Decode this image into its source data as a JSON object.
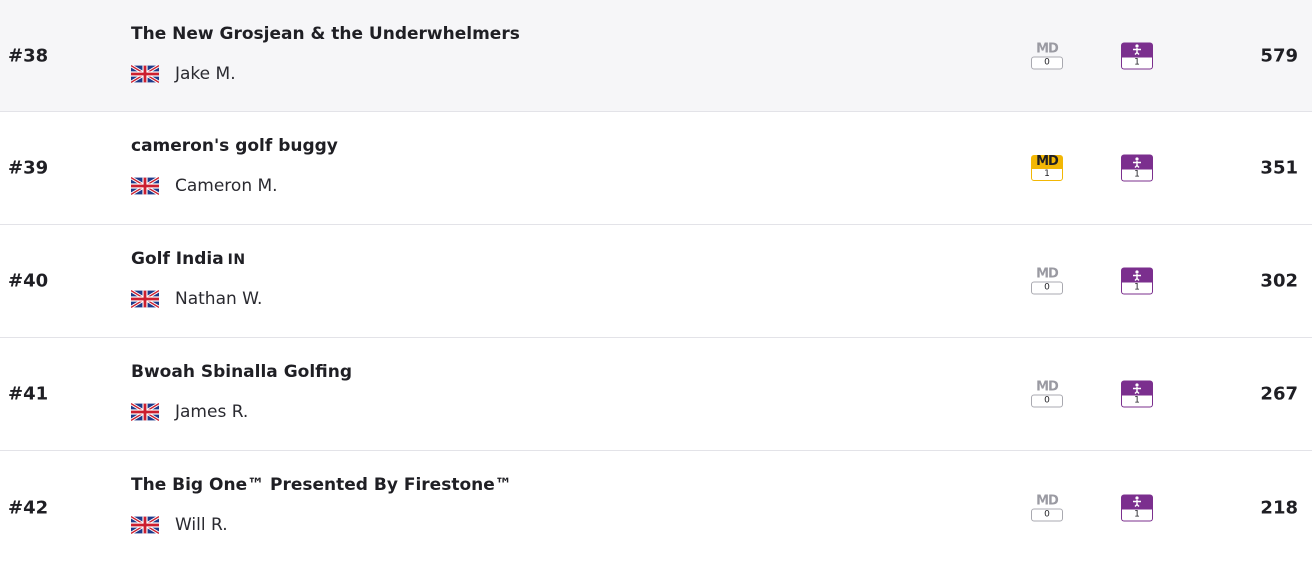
{
  "standings": {
    "rows": [
      {
        "rank": "#38",
        "team": "The New Grosjean & the Underwhelmers",
        "tag": "",
        "manager": "Jake M.",
        "flag_icon": "uk-flag-icon",
        "md_label": "MD",
        "md_value": "0",
        "md_active": false,
        "captain_value": "1",
        "points": "579"
      },
      {
        "rank": "#39",
        "team": "cameron's golf buggy",
        "tag": "",
        "manager": "Cameron M.",
        "flag_icon": "uk-flag-icon",
        "md_label": "MD",
        "md_value": "1",
        "md_active": true,
        "captain_value": "1",
        "points": "351"
      },
      {
        "rank": "#40",
        "team": "Golf India",
        "tag": "IN",
        "manager": "Nathan W.",
        "flag_icon": "uk-flag-icon",
        "md_label": "MD",
        "md_value": "0",
        "md_active": false,
        "captain_value": "1",
        "points": "302"
      },
      {
        "rank": "#41",
        "team": "Bwoah Sbinalla Golfing",
        "tag": "",
        "manager": "James R.",
        "flag_icon": "uk-flag-icon",
        "md_label": "MD",
        "md_value": "0",
        "md_active": false,
        "captain_value": "1",
        "points": "267"
      },
      {
        "rank": "#42",
        "team": "The Big One™ Presented By Firestone™",
        "tag": "",
        "manager": "Will R.",
        "flag_icon": "uk-flag-icon",
        "md_label": "MD",
        "md_value": "0",
        "md_active": false,
        "captain_value": "1",
        "points": "218"
      }
    ]
  },
  "colors": {
    "md_active": "#f2b705",
    "md_inactive": "#a9a9b0",
    "captain_chip": "#7b2f8e",
    "highlight_row": "#f6f6f8"
  }
}
